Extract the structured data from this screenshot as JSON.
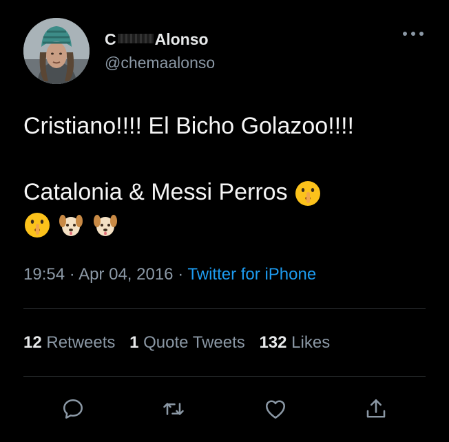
{
  "tweet": {
    "author": {
      "name_prefix": "C",
      "name_suffix": "Alonso",
      "handle": "@chemaalonso",
      "avatar_icon": "user-avatar-photo"
    },
    "more_icon": "more-options-icon",
    "text_line1": "Cristiano!!!! El Bicho Golazoo!!!!",
    "text_line2": "Catalonia & Messi Perros",
    "emojis_line2": [
      "shushing-face"
    ],
    "emojis_line3": [
      "shushing-face",
      "dog-face",
      "dog-face"
    ],
    "time": "19:54",
    "separator": "·",
    "date": "Apr 04, 2016",
    "source": "Twitter for iPhone",
    "stats": {
      "retweets_count": "12",
      "retweets_label": "Retweets",
      "quotes_count": "1",
      "quotes_label": "Quote Tweets",
      "likes_count": "132",
      "likes_label": "Likes"
    },
    "actions": [
      "reply-icon",
      "retweet-icon",
      "like-icon",
      "share-icon"
    ],
    "colors": {
      "background": "#000000",
      "link": "#1d9bf0",
      "secondary": "#8b98a5",
      "divider": "#2f3336"
    }
  }
}
